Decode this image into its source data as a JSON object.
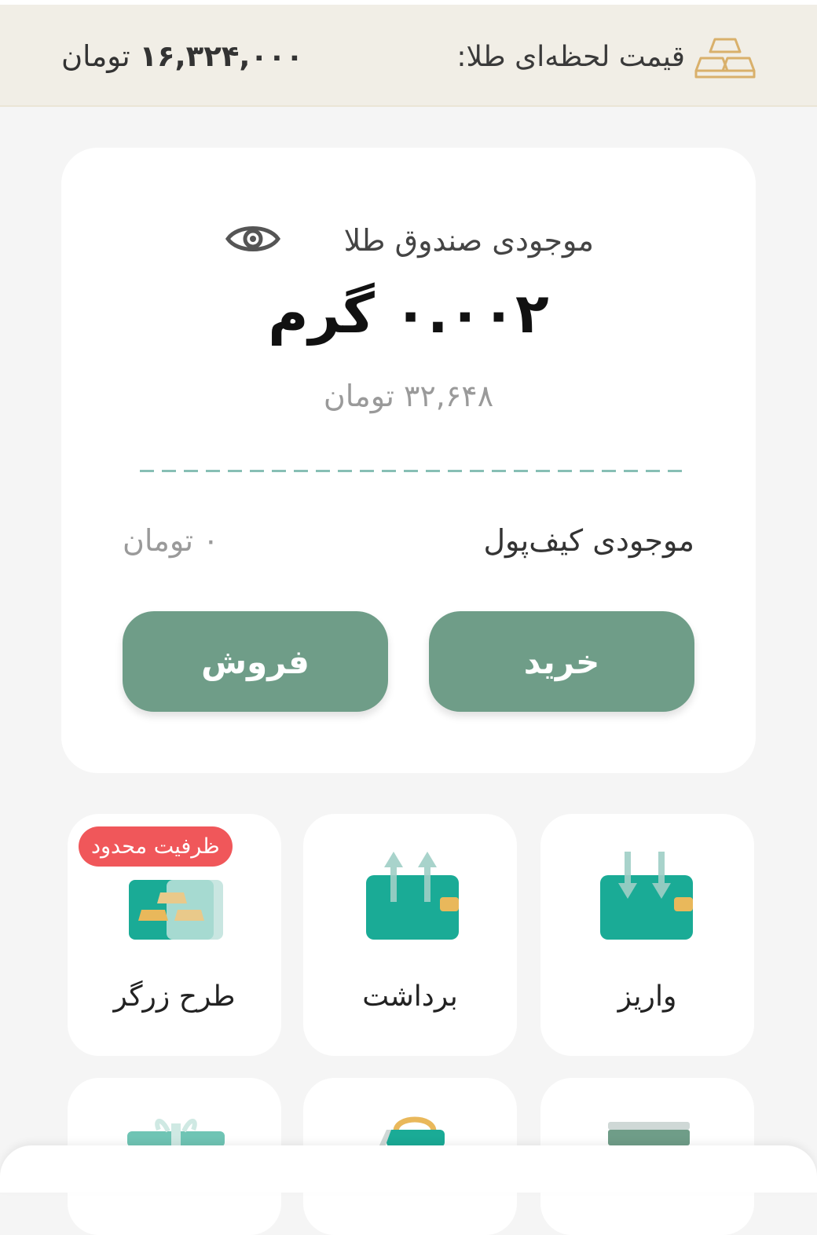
{
  "header": {
    "price_label": "قیمت لحظه‌ای طلا:",
    "price_value": "۱۶,۳۲۴,۰۰۰",
    "price_unit": "تومان",
    "icon": "gold-bars-icon"
  },
  "balance": {
    "title": "موجودی صندوق طلا",
    "gold_amount": "۰.۰۰۲ گرم",
    "toman_equivalent": "۳۲,۶۴۸ تومان",
    "wallet_label": "موجودی کیف‌پول",
    "wallet_value": "۰ تومان",
    "buy_label": "خرید",
    "sell_label": "فروش"
  },
  "tiles": [
    {
      "label": "واریز",
      "icon": "deposit-wallet-icon"
    },
    {
      "label": "برداشت",
      "icon": "withdraw-wallet-icon"
    },
    {
      "label": "طرح زرگر",
      "icon": "gold-plan-icon",
      "badge": "ظرفیت محدود"
    }
  ],
  "colors": {
    "accent": "#6f9d88",
    "wallet_teal": "#1aab96",
    "gold": "#e9b85b",
    "badge_red": "#f0575a",
    "header_bg": "#f1eee6"
  }
}
